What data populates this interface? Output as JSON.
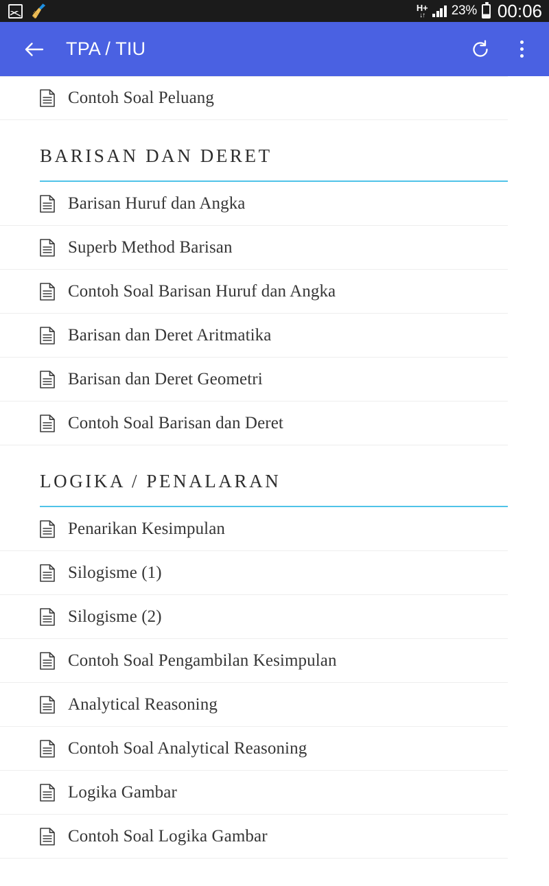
{
  "statusbar": {
    "icons": [
      "gallery-icon",
      "broom-icon"
    ],
    "network_type": "H+",
    "network_arrows": "↓↑",
    "battery_percent": "23%",
    "clock": "00:06"
  },
  "appbar": {
    "back_icon": "arrow-left-icon",
    "title": "TPA / TIU",
    "refresh_icon": "refresh-icon",
    "overflow_icon": "more-vertical-icon",
    "background_color": "#4a61e2"
  },
  "theme": {
    "accent_rule_color": "#4fc3e8",
    "divider_color": "#eeeeee",
    "text_color": "#363636"
  },
  "content": {
    "top_items": [
      {
        "label": "Contoh Soal Peluang",
        "icon": "document-icon"
      }
    ],
    "sections": [
      {
        "title": "BARISAN DAN DERET",
        "items": [
          {
            "label": "Barisan Huruf dan Angka",
            "icon": "document-icon"
          },
          {
            "label": "Superb Method Barisan",
            "icon": "document-icon"
          },
          {
            "label": "Contoh Soal Barisan Huruf dan Angka",
            "icon": "document-icon"
          },
          {
            "label": "Barisan dan Deret Aritmatika",
            "icon": "document-icon"
          },
          {
            "label": "Barisan dan Deret Geometri",
            "icon": "document-icon"
          },
          {
            "label": "Contoh Soal Barisan dan Deret",
            "icon": "document-icon"
          }
        ]
      },
      {
        "title": "LOGIKA / PENALARAN",
        "items": [
          {
            "label": "Penarikan Kesimpulan",
            "icon": "document-icon"
          },
          {
            "label": "Silogisme (1)",
            "icon": "document-icon"
          },
          {
            "label": "Silogisme (2)",
            "icon": "document-icon"
          },
          {
            "label": "Contoh Soal Pengambilan Kesimpulan",
            "icon": "document-icon"
          },
          {
            "label": "Analytical Reasoning",
            "icon": "document-icon"
          },
          {
            "label": "Contoh Soal Analytical Reasoning",
            "icon": "document-icon"
          },
          {
            "label": "Logika Gambar",
            "icon": "document-icon"
          },
          {
            "label": "Contoh Soal Logika Gambar",
            "icon": "document-icon"
          }
        ]
      }
    ]
  }
}
